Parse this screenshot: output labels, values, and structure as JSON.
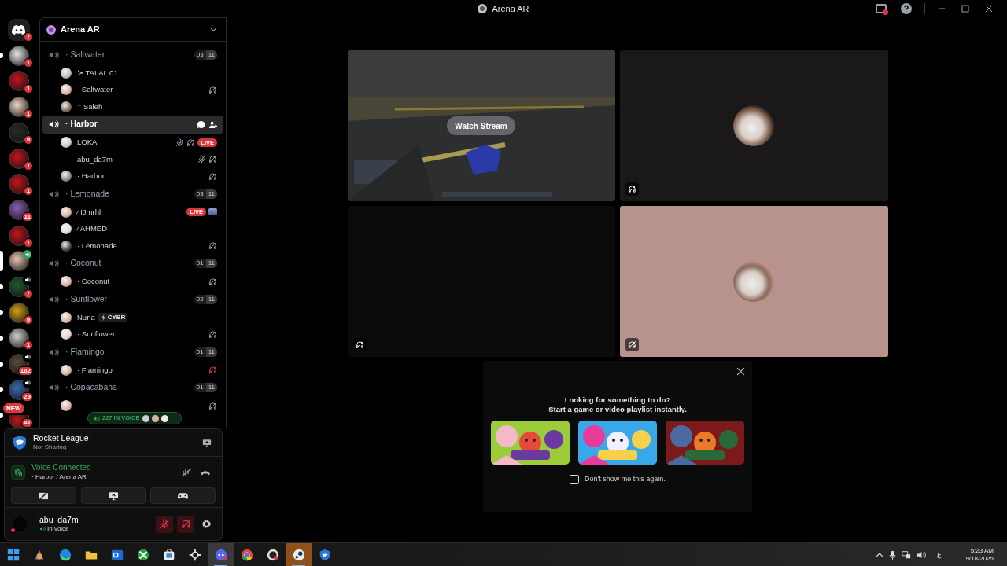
{
  "window": {
    "title": "Arena AR"
  },
  "server_rail": [
    {
      "kind": "home",
      "badge": "7",
      "unread": false,
      "selected": false,
      "voice": false
    },
    {
      "kind": "server",
      "badge": "1",
      "unread": true,
      "selected": false,
      "voice": false
    },
    {
      "kind": "server",
      "badge": "1",
      "unread": false,
      "selected": false,
      "voice": false
    },
    {
      "kind": "server",
      "badge": "1",
      "unread": false,
      "selected": false,
      "voice": false
    },
    {
      "kind": "server",
      "badge": "9",
      "unread": false,
      "selected": false,
      "voice": false
    },
    {
      "kind": "server",
      "badge": "1",
      "unread": false,
      "selected": false,
      "voice": false
    },
    {
      "kind": "server",
      "badge": "1",
      "unread": false,
      "selected": false,
      "voice": false
    },
    {
      "kind": "server",
      "badge": "11",
      "unread": false,
      "selected": false,
      "voice": false
    },
    {
      "kind": "server",
      "badge": "1",
      "unread": false,
      "selected": false,
      "voice": false
    },
    {
      "kind": "server",
      "unread": false,
      "selected": true,
      "voice": true
    },
    {
      "kind": "server",
      "badge": "7",
      "unread": true,
      "selected": false,
      "voice": true
    },
    {
      "kind": "server",
      "badge": "9",
      "unread": true,
      "selected": false,
      "voice": false
    },
    {
      "kind": "server",
      "badge": "1",
      "unread": true,
      "selected": false,
      "voice": false
    },
    {
      "kind": "server",
      "badge": "182",
      "unread": true,
      "selected": false,
      "voice": true
    },
    {
      "kind": "server",
      "badge": "29",
      "unread": true,
      "selected": false,
      "voice": true
    },
    {
      "kind": "server",
      "badge": "41",
      "label": "NEW",
      "unread": true,
      "selected": false,
      "voice": false
    }
  ],
  "channel_list": {
    "server_name": "Arena AR",
    "channels": [
      {
        "name": "· Saltwater",
        "selected": false,
        "user_count": "03",
        "user_limit": "11",
        "members": [
          {
            "name": "≻ TALAL 01",
            "avatar": true
          },
          {
            "name": "· Saltwater",
            "avatar": true,
            "icons": [
              {
                "kind": "deafened"
              }
            ]
          },
          {
            "name": "† Saleh",
            "avatar": true
          }
        ]
      },
      {
        "name": "· Harbor",
        "selected": true,
        "actions": [
          {
            "kind": "chat"
          },
          {
            "kind": "invite"
          }
        ],
        "members": [
          {
            "name": "LOKA.",
            "avatar": true,
            "icons": [
              {
                "kind": "muted"
              },
              {
                "kind": "deafened"
              },
              {
                "kind": "live",
                "text": "LIVE"
              }
            ]
          },
          {
            "name": "abu_da7m",
            "avatar": false,
            "icons": [
              {
                "kind": "muted"
              },
              {
                "kind": "deafened"
              }
            ]
          },
          {
            "name": "· Harbor",
            "avatar": true,
            "icons": [
              {
                "kind": "deafened"
              }
            ]
          }
        ]
      },
      {
        "name": "· Lemonade",
        "selected": false,
        "user_count": "03",
        "user_limit": "11",
        "members": [
          {
            "name": "⁄ IJmrhl",
            "avatar": true,
            "icons": [
              {
                "kind": "live",
                "text": "LIVE"
              },
              {
                "kind": "thumbnail"
              }
            ]
          },
          {
            "name": "⁄ AHMED",
            "avatar": true
          },
          {
            "name": "· Lemonade",
            "avatar": true,
            "icons": [
              {
                "kind": "deafened"
              }
            ]
          }
        ]
      },
      {
        "name": "· Coconut",
        "selected": false,
        "user_count": "01",
        "user_limit": "11",
        "members": [
          {
            "name": "· Coconut",
            "avatar": true,
            "icons": [
              {
                "kind": "deafened"
              }
            ]
          }
        ]
      },
      {
        "name": "· Sunflower",
        "selected": false,
        "user_count": "02",
        "user_limit": "11",
        "members": [
          {
            "name": "Nuna",
            "avatar": true,
            "tag": "CYBR"
          },
          {
            "name": "· Sunflower",
            "avatar": true,
            "icons": [
              {
                "kind": "deafened"
              }
            ]
          }
        ]
      },
      {
        "name": "· Flamingo",
        "selected": false,
        "user_count": "01",
        "user_limit": "11",
        "members": [
          {
            "name": "· Flamingo",
            "avatar": true,
            "icons": [
              {
                "kind": "alert"
              }
            ]
          }
        ]
      },
      {
        "name": "· Copacabana",
        "selected": false,
        "user_count": "01",
        "user_limit": "11",
        "members": [
          {
            "avatar": true,
            "icons": [
              {
                "kind": "deafened"
              }
            ]
          }
        ]
      }
    ],
    "voice_pill": {
      "text": "227 IN VOICE"
    }
  },
  "activity": {
    "title": "Rocket League",
    "subtitle": "Not Sharing"
  },
  "voice": {
    "status": "Voice Connected",
    "location": "· Harbor / Arena AR",
    "buttons": [
      {
        "kind": "camera_off"
      },
      {
        "kind": "share"
      },
      {
        "kind": "activity"
      }
    ]
  },
  "user": {
    "name": "abu_da7m",
    "status": "In voice",
    "muted": true,
    "deafened": true
  },
  "tiles": [
    {
      "kind": "stream",
      "button": "Watch Stream",
      "muted": false
    },
    {
      "kind": "avatar",
      "color": "#1a1818",
      "muted": true
    },
    {
      "kind": "empty",
      "color": "#0b0b0b",
      "muted": true
    },
    {
      "kind": "avatar",
      "color": "#b8938d",
      "muted": true
    }
  ],
  "activity_prompt": {
    "heading": "Looking for something to do?",
    "subheading": "Start a game or video playlist instantly.",
    "checkbox": {
      "label": "Don't show me this again.",
      "checked": false
    }
  },
  "taskbar": {
    "apps": [
      {
        "kind": "start",
        "selected": false
      },
      {
        "kind": "copilot",
        "selected": false
      },
      {
        "kind": "edge",
        "selected": false
      },
      {
        "kind": "files",
        "selected": false
      },
      {
        "kind": "outlook",
        "selected": false
      },
      {
        "kind": "xbox",
        "selected": false
      },
      {
        "kind": "store",
        "selected": false
      },
      {
        "kind": "steelseries",
        "selected": false
      },
      {
        "kind": "discord",
        "selected": true
      },
      {
        "kind": "chrome",
        "selected": false
      },
      {
        "kind": "epic",
        "selected": false
      },
      {
        "kind": "steam",
        "selected": true
      },
      {
        "kind": "rocket",
        "selected": false
      }
    ],
    "language": "ع",
    "time": "5:23 AM",
    "date": "9/18/2025"
  }
}
